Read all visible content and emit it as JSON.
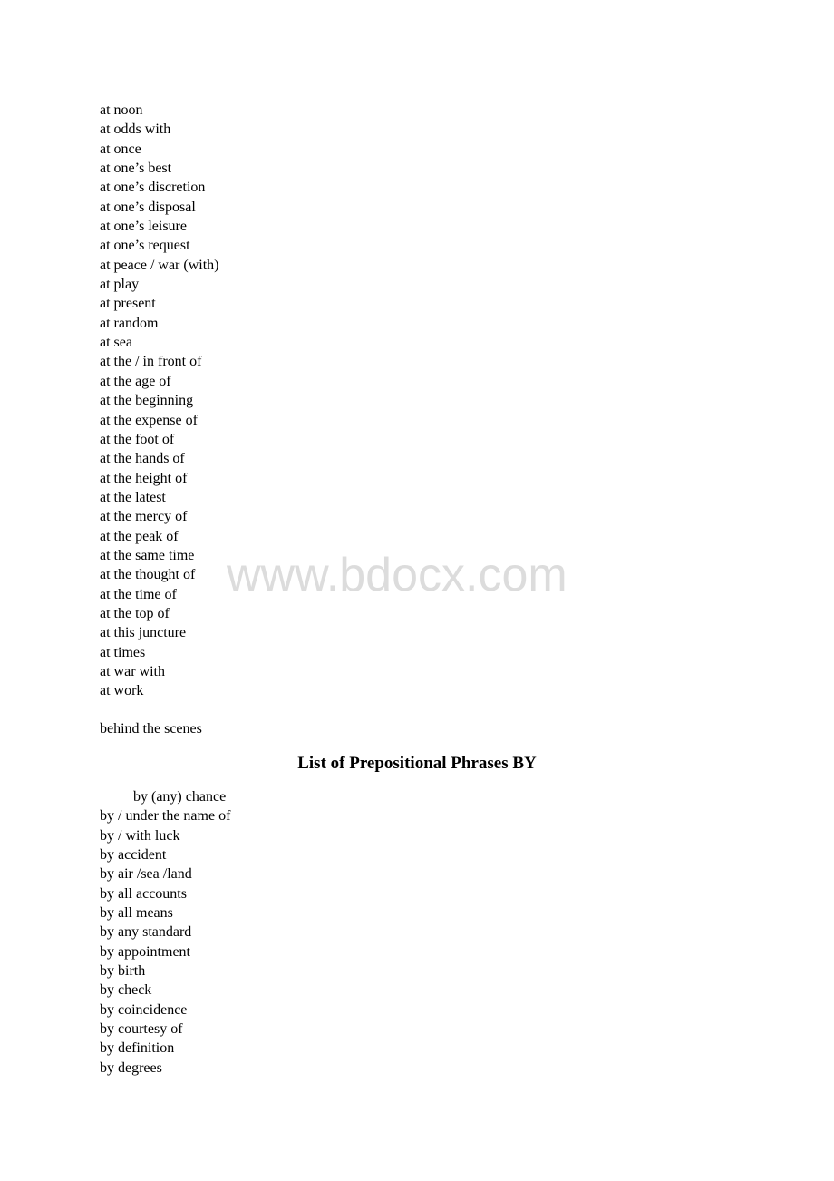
{
  "at_section": {
    "items": [
      "at noon",
      "at odds with",
      "at once",
      "at one’s best",
      "at one’s discretion",
      "at one’s disposal",
      "at one’s leisure",
      "at one’s request",
      "at peace / war (with)",
      "at play",
      "at present",
      "at random",
      "at sea",
      "at the / in front of",
      "at the age of",
      "at the beginning",
      "at the expense of",
      "at the foot of",
      "at the hands of",
      "at the height of",
      "at the latest",
      "at the mercy of",
      "at the peak of",
      "at the same time",
      "at the thought of",
      "at the time of",
      "at the top of",
      "at this juncture",
      "at times",
      "at war with",
      "at work"
    ]
  },
  "behind_section": {
    "items": [
      "behind the scenes"
    ]
  },
  "by_section": {
    "title": "List of Prepositional Phrases BY",
    "items": [
      "by (any) chance",
      "by / under the name of",
      "by / with luck",
      "by accident",
      "by air /sea /land",
      "by all accounts",
      "by all means",
      "by any standard",
      "by appointment",
      "by birth",
      "by check",
      "by coincidence",
      "by courtesy of",
      "by definition",
      "by degrees"
    ]
  },
  "watermark": "www.bdocx.com"
}
